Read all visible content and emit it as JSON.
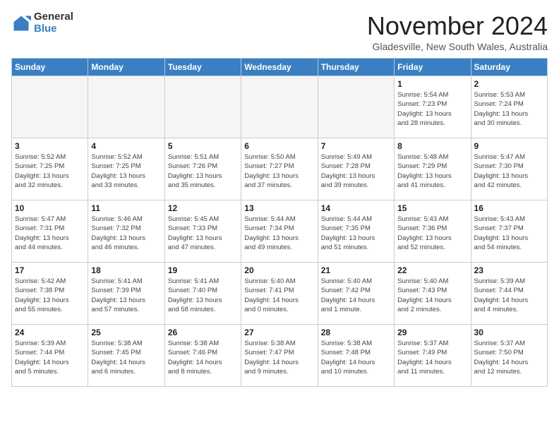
{
  "logo": {
    "general": "General",
    "blue": "Blue"
  },
  "title": "November 2024",
  "location": "Gladesville, New South Wales, Australia",
  "weekdays": [
    "Sunday",
    "Monday",
    "Tuesday",
    "Wednesday",
    "Thursday",
    "Friday",
    "Saturday"
  ],
  "weeks": [
    [
      {
        "day": "",
        "info": ""
      },
      {
        "day": "",
        "info": ""
      },
      {
        "day": "",
        "info": ""
      },
      {
        "day": "",
        "info": ""
      },
      {
        "day": "",
        "info": ""
      },
      {
        "day": "1",
        "info": "Sunrise: 5:54 AM\nSunset: 7:23 PM\nDaylight: 13 hours\nand 28 minutes."
      },
      {
        "day": "2",
        "info": "Sunrise: 5:53 AM\nSunset: 7:24 PM\nDaylight: 13 hours\nand 30 minutes."
      }
    ],
    [
      {
        "day": "3",
        "info": "Sunrise: 5:52 AM\nSunset: 7:25 PM\nDaylight: 13 hours\nand 32 minutes."
      },
      {
        "day": "4",
        "info": "Sunrise: 5:52 AM\nSunset: 7:25 PM\nDaylight: 13 hours\nand 33 minutes."
      },
      {
        "day": "5",
        "info": "Sunrise: 5:51 AM\nSunset: 7:26 PM\nDaylight: 13 hours\nand 35 minutes."
      },
      {
        "day": "6",
        "info": "Sunrise: 5:50 AM\nSunset: 7:27 PM\nDaylight: 13 hours\nand 37 minutes."
      },
      {
        "day": "7",
        "info": "Sunrise: 5:49 AM\nSunset: 7:28 PM\nDaylight: 13 hours\nand 39 minutes."
      },
      {
        "day": "8",
        "info": "Sunrise: 5:48 AM\nSunset: 7:29 PM\nDaylight: 13 hours\nand 41 minutes."
      },
      {
        "day": "9",
        "info": "Sunrise: 5:47 AM\nSunset: 7:30 PM\nDaylight: 13 hours\nand 42 minutes."
      }
    ],
    [
      {
        "day": "10",
        "info": "Sunrise: 5:47 AM\nSunset: 7:31 PM\nDaylight: 13 hours\nand 44 minutes."
      },
      {
        "day": "11",
        "info": "Sunrise: 5:46 AM\nSunset: 7:32 PM\nDaylight: 13 hours\nand 46 minutes."
      },
      {
        "day": "12",
        "info": "Sunrise: 5:45 AM\nSunset: 7:33 PM\nDaylight: 13 hours\nand 47 minutes."
      },
      {
        "day": "13",
        "info": "Sunrise: 5:44 AM\nSunset: 7:34 PM\nDaylight: 13 hours\nand 49 minutes."
      },
      {
        "day": "14",
        "info": "Sunrise: 5:44 AM\nSunset: 7:35 PM\nDaylight: 13 hours\nand 51 minutes."
      },
      {
        "day": "15",
        "info": "Sunrise: 5:43 AM\nSunset: 7:36 PM\nDaylight: 13 hours\nand 52 minutes."
      },
      {
        "day": "16",
        "info": "Sunrise: 5:43 AM\nSunset: 7:37 PM\nDaylight: 13 hours\nand 54 minutes."
      }
    ],
    [
      {
        "day": "17",
        "info": "Sunrise: 5:42 AM\nSunset: 7:38 PM\nDaylight: 13 hours\nand 55 minutes."
      },
      {
        "day": "18",
        "info": "Sunrise: 5:41 AM\nSunset: 7:39 PM\nDaylight: 13 hours\nand 57 minutes."
      },
      {
        "day": "19",
        "info": "Sunrise: 5:41 AM\nSunset: 7:40 PM\nDaylight: 13 hours\nand 58 minutes."
      },
      {
        "day": "20",
        "info": "Sunrise: 5:40 AM\nSunset: 7:41 PM\nDaylight: 14 hours\nand 0 minutes."
      },
      {
        "day": "21",
        "info": "Sunrise: 5:40 AM\nSunset: 7:42 PM\nDaylight: 14 hours\nand 1 minute."
      },
      {
        "day": "22",
        "info": "Sunrise: 5:40 AM\nSunset: 7:43 PM\nDaylight: 14 hours\nand 2 minutes."
      },
      {
        "day": "23",
        "info": "Sunrise: 5:39 AM\nSunset: 7:44 PM\nDaylight: 14 hours\nand 4 minutes."
      }
    ],
    [
      {
        "day": "24",
        "info": "Sunrise: 5:39 AM\nSunset: 7:44 PM\nDaylight: 14 hours\nand 5 minutes."
      },
      {
        "day": "25",
        "info": "Sunrise: 5:38 AM\nSunset: 7:45 PM\nDaylight: 14 hours\nand 6 minutes."
      },
      {
        "day": "26",
        "info": "Sunrise: 5:38 AM\nSunset: 7:46 PM\nDaylight: 14 hours\nand 8 minutes."
      },
      {
        "day": "27",
        "info": "Sunrise: 5:38 AM\nSunset: 7:47 PM\nDaylight: 14 hours\nand 9 minutes."
      },
      {
        "day": "28",
        "info": "Sunrise: 5:38 AM\nSunset: 7:48 PM\nDaylight: 14 hours\nand 10 minutes."
      },
      {
        "day": "29",
        "info": "Sunrise: 5:37 AM\nSunset: 7:49 PM\nDaylight: 14 hours\nand 11 minutes."
      },
      {
        "day": "30",
        "info": "Sunrise: 5:37 AM\nSunset: 7:50 PM\nDaylight: 14 hours\nand 12 minutes."
      }
    ]
  ]
}
